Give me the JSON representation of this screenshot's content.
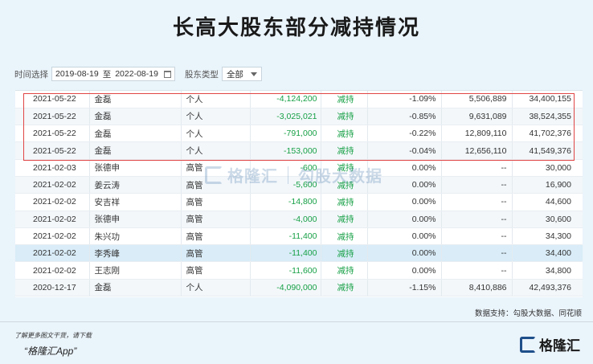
{
  "title": "长高大股东部分减持情况",
  "filters": {
    "time_label": "时间选择",
    "date_from": "2019-08-19",
    "date_to_sep": "至",
    "date_to": "2022-08-19",
    "holder_type_label": "股东类型",
    "holder_type_value": "全部"
  },
  "table": {
    "rows": [
      {
        "date": "2021-05-22",
        "name": "金磊",
        "type": "个人",
        "change": "-4,124,200",
        "direction": "减持",
        "pct": "-1.09%",
        "holding": "5,506,889",
        "total": "34,400,155"
      },
      {
        "date": "2021-05-22",
        "name": "金磊",
        "type": "个人",
        "change": "-3,025,021",
        "direction": "减持",
        "pct": "-0.85%",
        "holding": "9,631,089",
        "total": "38,524,355"
      },
      {
        "date": "2021-05-22",
        "name": "金磊",
        "type": "个人",
        "change": "-791,000",
        "direction": "减持",
        "pct": "-0.22%",
        "holding": "12,809,110",
        "total": "41,702,376"
      },
      {
        "date": "2021-05-22",
        "name": "金磊",
        "type": "个人",
        "change": "-153,000",
        "direction": "减持",
        "pct": "-0.04%",
        "holding": "12,656,110",
        "total": "41,549,376"
      },
      {
        "date": "2021-02-03",
        "name": "张德申",
        "type": "高管",
        "change": "-600",
        "direction": "减持",
        "pct": "0.00%",
        "holding": "--",
        "total": "30,000"
      },
      {
        "date": "2021-02-02",
        "name": "姜云涛",
        "type": "高管",
        "change": "-5,600",
        "direction": "减持",
        "pct": "0.00%",
        "holding": "--",
        "total": "16,900"
      },
      {
        "date": "2021-02-02",
        "name": "安吉祥",
        "type": "高管",
        "change": "-14,800",
        "direction": "减持",
        "pct": "0.00%",
        "holding": "--",
        "total": "44,600"
      },
      {
        "date": "2021-02-02",
        "name": "张德申",
        "type": "高管",
        "change": "-4,000",
        "direction": "减持",
        "pct": "0.00%",
        "holding": "--",
        "total": "30,600"
      },
      {
        "date": "2021-02-02",
        "name": "朱兴功",
        "type": "高管",
        "change": "-11,400",
        "direction": "减持",
        "pct": "0.00%",
        "holding": "--",
        "total": "34,300"
      },
      {
        "date": "2021-02-02",
        "name": "李秀峰",
        "type": "高管",
        "change": "-11,400",
        "direction": "减持",
        "pct": "0.00%",
        "holding": "--",
        "total": "34,400"
      },
      {
        "date": "2021-02-02",
        "name": "王志刚",
        "type": "高管",
        "change": "-11,600",
        "direction": "减持",
        "pct": "0.00%",
        "holding": "--",
        "total": "34,800"
      },
      {
        "date": "2020-12-17",
        "name": "金磊",
        "type": "个人",
        "change": "-4,090,000",
        "direction": "减持",
        "pct": "-1.15%",
        "holding": "8,410,886",
        "total": "42,493,376"
      }
    ]
  },
  "watermark": {
    "brand": "格隆汇",
    "text": "勾股大数据"
  },
  "source": "数据支持：勾股大数据、同花顺",
  "footer": {
    "line1": "了解更多图文干货，请下载",
    "line2": "“格隆汇App”",
    "logo_text": "格隆汇"
  },
  "colors": {
    "decrease": "#17a046",
    "highlight_border": "#e04545",
    "selected_row": "#d9ecf8"
  }
}
